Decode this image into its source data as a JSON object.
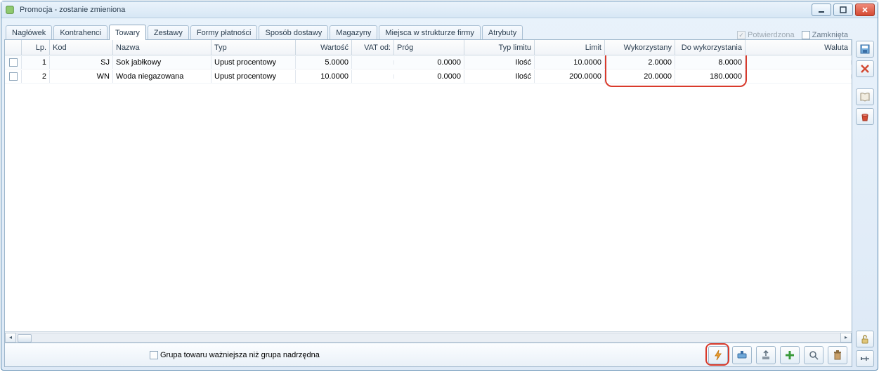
{
  "window": {
    "title": "Promocja - zostanie zmieniona"
  },
  "tabs": [
    {
      "label": "Nagłówek"
    },
    {
      "label": "Kontrahenci"
    },
    {
      "label": "Towary",
      "active": true
    },
    {
      "label": "Zestawy"
    },
    {
      "label": "Formy płatności"
    },
    {
      "label": "Sposób dostawy"
    },
    {
      "label": "Magazyny"
    },
    {
      "label": "Miejsca w strukturze firmy"
    },
    {
      "label": "Atrybuty"
    }
  ],
  "flags": {
    "confirmed_label": "Potwierdzona",
    "confirmed_checked": true,
    "closed_label": "Zamknięta",
    "closed_checked": false
  },
  "columns": {
    "lp": "Lp.",
    "kod": "Kod",
    "nazwa": "Nazwa",
    "typ": "Typ",
    "wartosc": "Wartość",
    "vat_od": "VAT od:",
    "prog": "Próg",
    "typ_limitu": "Typ limitu",
    "limit": "Limit",
    "wykorzystany": "Wykorzystany",
    "do_wykorzystania": "Do wykorzystania",
    "waluta": "Waluta"
  },
  "rows": [
    {
      "lp": "1",
      "kod": "SJ",
      "nazwa": "Sok jabłkowy",
      "typ": "Upust procentowy",
      "wartosc": "5.0000",
      "vat_od": "",
      "prog": "0.0000",
      "typ_limitu": "Ilość",
      "limit": "10.0000",
      "wykorzystany": "2.0000",
      "do_wykorzystania": "8.0000",
      "waluta": ""
    },
    {
      "lp": "2",
      "kod": "WN",
      "nazwa": "Woda niegazowana",
      "typ": "Upust procentowy",
      "wartosc": "10.0000",
      "vat_od": "",
      "prog": "0.0000",
      "typ_limitu": "Ilość",
      "limit": "200.0000",
      "wykorzystany": "20.0000",
      "do_wykorzystania": "180.0000",
      "waluta": ""
    }
  ],
  "footer": {
    "group_priority_label": "Grupa towaru ważniejsza niż grupa nadrzędna"
  }
}
